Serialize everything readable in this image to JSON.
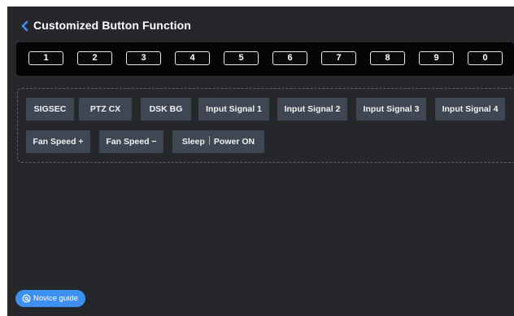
{
  "header": {
    "title": "Customized Button Function",
    "back_icon": "chevron-left-icon"
  },
  "keypad": {
    "keys": [
      "1",
      "2",
      "3",
      "4",
      "5",
      "6",
      "7",
      "8",
      "9",
      "0"
    ]
  },
  "functions": {
    "row1": [
      "SIGSEC",
      "PTZ CX",
      "DSK BG",
      "Input Signal 1",
      "Input Signal 2",
      "Input Signal 3",
      "Input Signal 4"
    ],
    "row2": {
      "fan_up": "Fan Speed +",
      "fan_down": "Fan Speed −",
      "sleep": "Sleep",
      "power_on": "Power ON"
    }
  },
  "novice_guide": {
    "label": "Novice guide",
    "icon": "help-circle-icon"
  },
  "colors": {
    "background": "#25272b",
    "keypad_bg": "#050505",
    "button_bg": "#3f4754",
    "accent": "#3d8ff0",
    "back_icon": "#3d8ff0"
  }
}
